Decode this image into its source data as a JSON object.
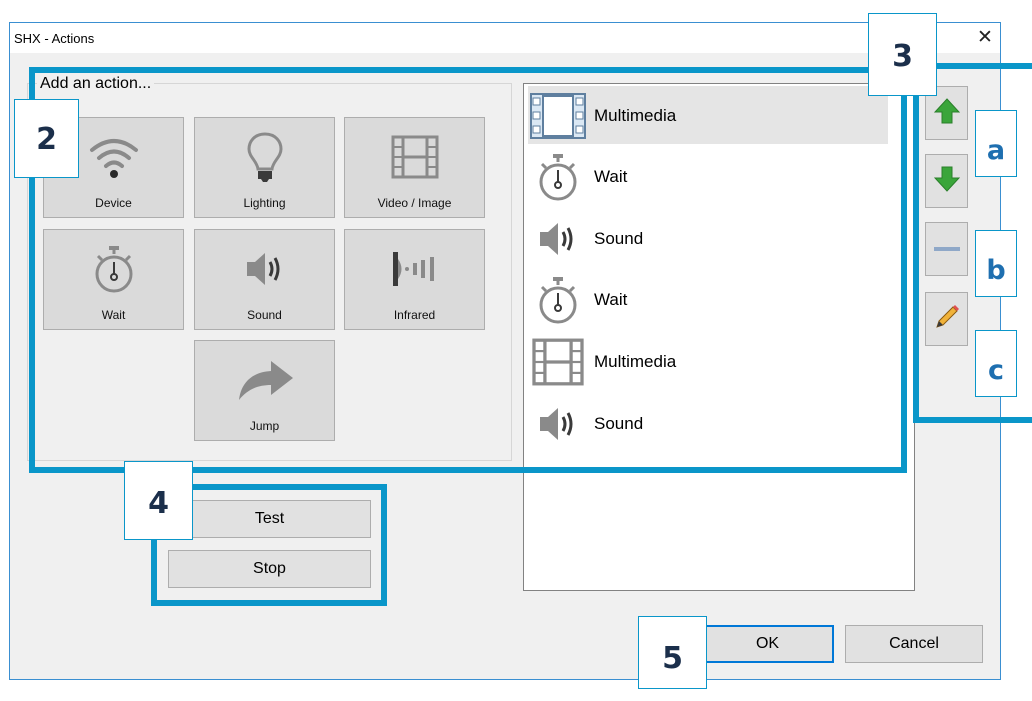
{
  "window": {
    "title": "SHX - Actions",
    "close_glyph": "✕"
  },
  "add_action": {
    "title": "Add an action...",
    "tiles": [
      {
        "label": "Device",
        "icon": "wifi-icon"
      },
      {
        "label": "Lighting",
        "icon": "lightbulb-icon"
      },
      {
        "label": "Video / Image",
        "icon": "film-icon"
      },
      {
        "label": "Wait",
        "icon": "stopwatch-icon"
      },
      {
        "label": "Sound",
        "icon": "speaker-icon"
      },
      {
        "label": "Infrared",
        "icon": "infrared-icon"
      },
      {
        "label": "Jump",
        "icon": "jump-arrow-icon"
      }
    ]
  },
  "action_list": {
    "items": [
      {
        "label": "Multimedia",
        "icon": "film-icon",
        "selected": true
      },
      {
        "label": "Wait",
        "icon": "stopwatch-icon"
      },
      {
        "label": "Sound",
        "icon": "speaker-icon"
      },
      {
        "label": "Wait",
        "icon": "stopwatch-icon"
      },
      {
        "label": "Multimedia",
        "icon": "film-icon"
      },
      {
        "label": "Sound",
        "icon": "speaker-icon"
      }
    ]
  },
  "side_buttons": [
    {
      "icon": "move-up-arrow-icon"
    },
    {
      "icon": "move-down-arrow-icon"
    },
    {
      "icon": "remove-minus-icon"
    },
    {
      "icon": "edit-pencil-icon"
    }
  ],
  "test_buttons": {
    "test_label": "Test",
    "stop_label": "Stop"
  },
  "footer": {
    "ok_label": "OK",
    "cancel_label": "Cancel"
  },
  "annotations": {
    "n2": "2",
    "n3": "3",
    "n4": "4",
    "n5": "5",
    "a": "a",
    "b": "b",
    "c": "c"
  },
  "colors": {
    "highlight": "#0a96c9",
    "callout_text": "#1b2f4b",
    "up_arrow": "#3aa53a",
    "ok_border": "#0078d7"
  }
}
